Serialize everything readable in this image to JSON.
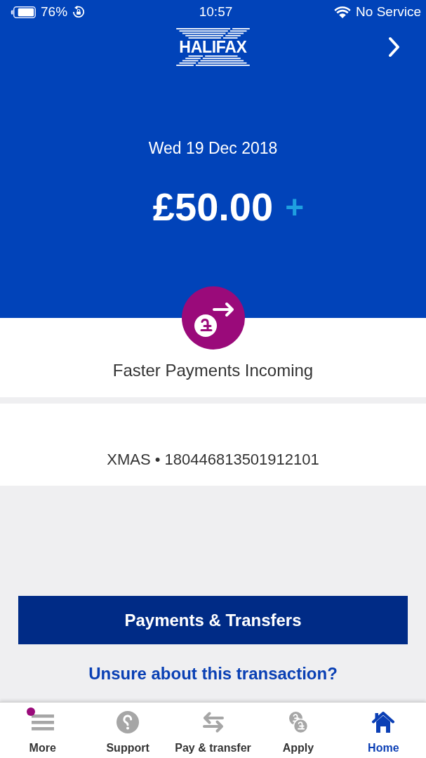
{
  "status_bar": {
    "battery": "76%",
    "time": "10:57",
    "carrier": "No Service"
  },
  "header": {
    "logo": "HALIFAX"
  },
  "transaction": {
    "date": "Wed 19 Dec 2018",
    "amount": "£50.00",
    "sign": "+",
    "type": "Faster Payments Incoming",
    "reference": "XMAS • 180446813501912101"
  },
  "actions": {
    "button": "Payments & Transfers",
    "link": "Unsure about this transaction?"
  },
  "tab_bar": [
    {
      "kind": "more",
      "label": "More",
      "selected": false,
      "notification": true
    },
    {
      "kind": "support",
      "label": "Support",
      "selected": false,
      "notification": false
    },
    {
      "kind": "transfer",
      "label": "Pay & transfer",
      "selected": false,
      "notification": false
    },
    {
      "kind": "apply",
      "label": "Apply",
      "selected": false,
      "notification": false
    },
    {
      "kind": "home",
      "label": "Home",
      "selected": true,
      "notification": false
    }
  ]
}
